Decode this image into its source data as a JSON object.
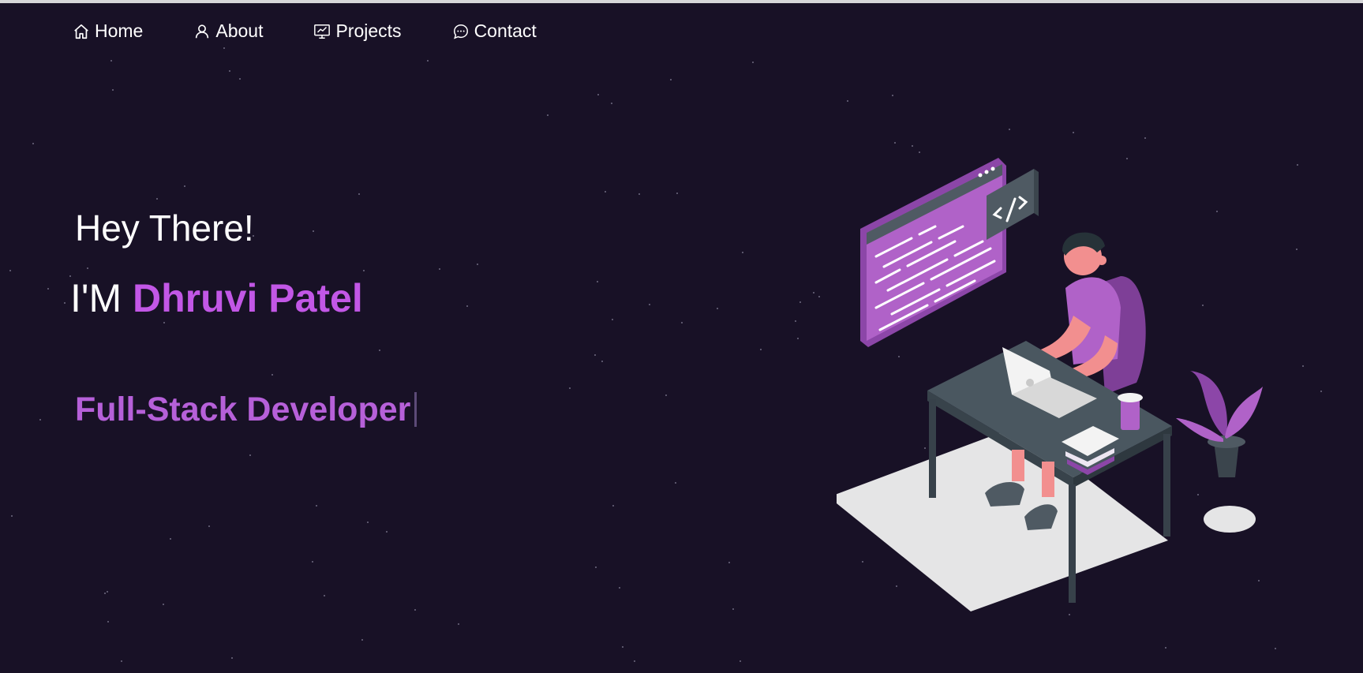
{
  "colors": {
    "background": "#181126",
    "accent": "#c257e6",
    "role_text": "#b660d9",
    "text": "#ffffff"
  },
  "nav": {
    "items": [
      {
        "label": "Home",
        "icon": "home-icon"
      },
      {
        "label": "About",
        "icon": "user-icon"
      },
      {
        "label": "Projects",
        "icon": "presentation-icon"
      },
      {
        "label": "Contact",
        "icon": "chat-icon"
      }
    ]
  },
  "hero": {
    "greeting": "Hey There!",
    "intro_prefix": "I'M ",
    "name": "Dhruvi Patel",
    "role": "Full-Stack Developer"
  }
}
